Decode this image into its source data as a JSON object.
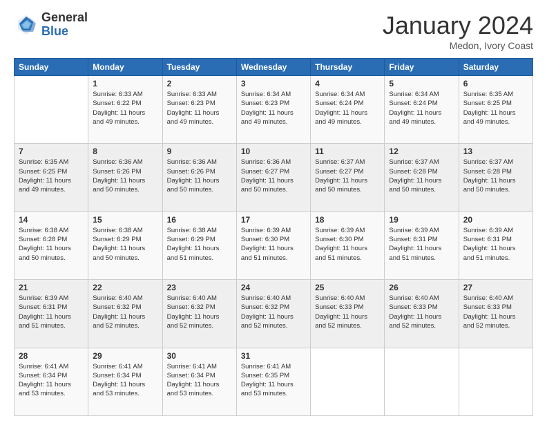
{
  "logo": {
    "general": "General",
    "blue": "Blue"
  },
  "header": {
    "month": "January 2024",
    "location": "Medon, Ivory Coast"
  },
  "days_of_week": [
    "Sunday",
    "Monday",
    "Tuesday",
    "Wednesday",
    "Thursday",
    "Friday",
    "Saturday"
  ],
  "weeks": [
    [
      {
        "day": "",
        "info": ""
      },
      {
        "day": "1",
        "info": "Sunrise: 6:33 AM\nSunset: 6:22 PM\nDaylight: 11 hours\nand 49 minutes."
      },
      {
        "day": "2",
        "info": "Sunrise: 6:33 AM\nSunset: 6:23 PM\nDaylight: 11 hours\nand 49 minutes."
      },
      {
        "day": "3",
        "info": "Sunrise: 6:34 AM\nSunset: 6:23 PM\nDaylight: 11 hours\nand 49 minutes."
      },
      {
        "day": "4",
        "info": "Sunrise: 6:34 AM\nSunset: 6:24 PM\nDaylight: 11 hours\nand 49 minutes."
      },
      {
        "day": "5",
        "info": "Sunrise: 6:34 AM\nSunset: 6:24 PM\nDaylight: 11 hours\nand 49 minutes."
      },
      {
        "day": "6",
        "info": "Sunrise: 6:35 AM\nSunset: 6:25 PM\nDaylight: 11 hours\nand 49 minutes."
      }
    ],
    [
      {
        "day": "7",
        "info": "Sunrise: 6:35 AM\nSunset: 6:25 PM\nDaylight: 11 hours\nand 49 minutes."
      },
      {
        "day": "8",
        "info": "Sunrise: 6:36 AM\nSunset: 6:26 PM\nDaylight: 11 hours\nand 50 minutes."
      },
      {
        "day": "9",
        "info": "Sunrise: 6:36 AM\nSunset: 6:26 PM\nDaylight: 11 hours\nand 50 minutes."
      },
      {
        "day": "10",
        "info": "Sunrise: 6:36 AM\nSunset: 6:27 PM\nDaylight: 11 hours\nand 50 minutes."
      },
      {
        "day": "11",
        "info": "Sunrise: 6:37 AM\nSunset: 6:27 PM\nDaylight: 11 hours\nand 50 minutes."
      },
      {
        "day": "12",
        "info": "Sunrise: 6:37 AM\nSunset: 6:28 PM\nDaylight: 11 hours\nand 50 minutes."
      },
      {
        "day": "13",
        "info": "Sunrise: 6:37 AM\nSunset: 6:28 PM\nDaylight: 11 hours\nand 50 minutes."
      }
    ],
    [
      {
        "day": "14",
        "info": "Sunrise: 6:38 AM\nSunset: 6:28 PM\nDaylight: 11 hours\nand 50 minutes."
      },
      {
        "day": "15",
        "info": "Sunrise: 6:38 AM\nSunset: 6:29 PM\nDaylight: 11 hours\nand 50 minutes."
      },
      {
        "day": "16",
        "info": "Sunrise: 6:38 AM\nSunset: 6:29 PM\nDaylight: 11 hours\nand 51 minutes."
      },
      {
        "day": "17",
        "info": "Sunrise: 6:39 AM\nSunset: 6:30 PM\nDaylight: 11 hours\nand 51 minutes."
      },
      {
        "day": "18",
        "info": "Sunrise: 6:39 AM\nSunset: 6:30 PM\nDaylight: 11 hours\nand 51 minutes."
      },
      {
        "day": "19",
        "info": "Sunrise: 6:39 AM\nSunset: 6:31 PM\nDaylight: 11 hours\nand 51 minutes."
      },
      {
        "day": "20",
        "info": "Sunrise: 6:39 AM\nSunset: 6:31 PM\nDaylight: 11 hours\nand 51 minutes."
      }
    ],
    [
      {
        "day": "21",
        "info": "Sunrise: 6:39 AM\nSunset: 6:31 PM\nDaylight: 11 hours\nand 51 minutes."
      },
      {
        "day": "22",
        "info": "Sunrise: 6:40 AM\nSunset: 6:32 PM\nDaylight: 11 hours\nand 52 minutes."
      },
      {
        "day": "23",
        "info": "Sunrise: 6:40 AM\nSunset: 6:32 PM\nDaylight: 11 hours\nand 52 minutes."
      },
      {
        "day": "24",
        "info": "Sunrise: 6:40 AM\nSunset: 6:32 PM\nDaylight: 11 hours\nand 52 minutes."
      },
      {
        "day": "25",
        "info": "Sunrise: 6:40 AM\nSunset: 6:33 PM\nDaylight: 11 hours\nand 52 minutes."
      },
      {
        "day": "26",
        "info": "Sunrise: 6:40 AM\nSunset: 6:33 PM\nDaylight: 11 hours\nand 52 minutes."
      },
      {
        "day": "27",
        "info": "Sunrise: 6:40 AM\nSunset: 6:33 PM\nDaylight: 11 hours\nand 52 minutes."
      }
    ],
    [
      {
        "day": "28",
        "info": "Sunrise: 6:41 AM\nSunset: 6:34 PM\nDaylight: 11 hours\nand 53 minutes."
      },
      {
        "day": "29",
        "info": "Sunrise: 6:41 AM\nSunset: 6:34 PM\nDaylight: 11 hours\nand 53 minutes."
      },
      {
        "day": "30",
        "info": "Sunrise: 6:41 AM\nSunset: 6:34 PM\nDaylight: 11 hours\nand 53 minutes."
      },
      {
        "day": "31",
        "info": "Sunrise: 6:41 AM\nSunset: 6:35 PM\nDaylight: 11 hours\nand 53 minutes."
      },
      {
        "day": "",
        "info": ""
      },
      {
        "day": "",
        "info": ""
      },
      {
        "day": "",
        "info": ""
      }
    ]
  ]
}
